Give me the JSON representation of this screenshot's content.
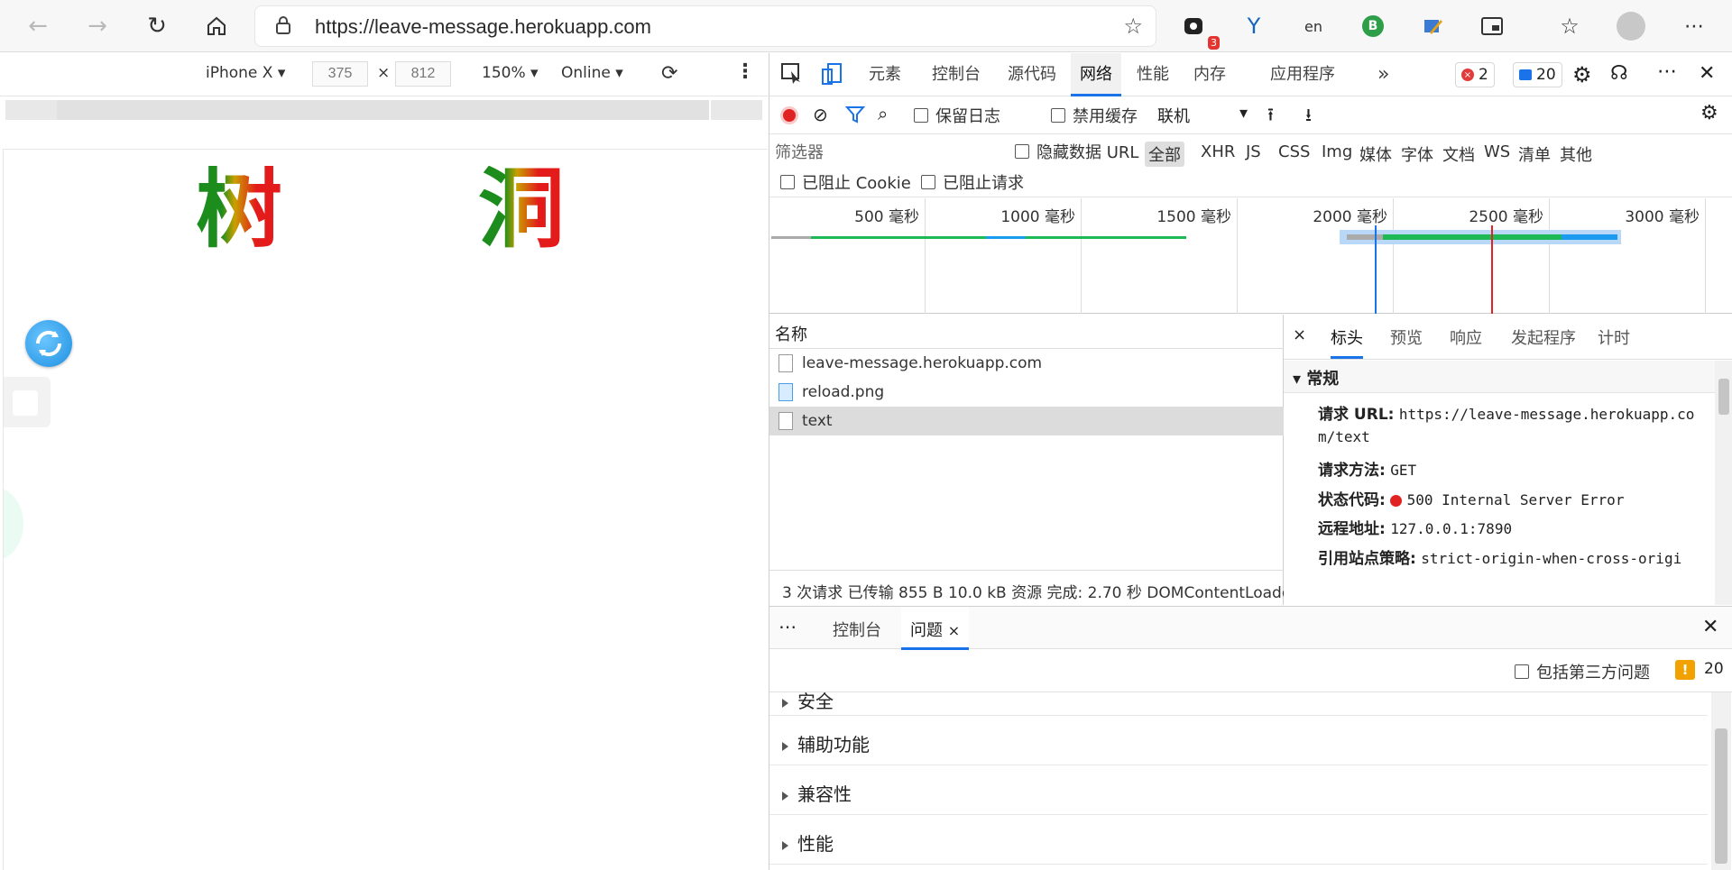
{
  "browser": {
    "url": "https://leave-message.herokuapp.com",
    "extension_badge": "3",
    "profile_letter": "B"
  },
  "device_toolbar": {
    "device": "iPhone X",
    "width": "375",
    "times": "×",
    "height": "812",
    "zoom": "150%",
    "throttle": "Online"
  },
  "page": {
    "char_left": "树",
    "char_right": "洞"
  },
  "devtools": {
    "tabs": [
      "元素",
      "控制台",
      "源代码",
      "网络",
      "性能",
      "内存",
      "应用程序"
    ],
    "active_tab": "网络",
    "more_tabs": "»",
    "error_count": "2",
    "message_count": "20",
    "toolbar": {
      "preserve_log": "保留日志",
      "disable_cache": "禁用缓存",
      "throttle": "联机"
    },
    "filter": {
      "placeholder": "筛选器",
      "hide_data_urls": "隐藏数据 URL",
      "types": [
        "全部",
        "XHR",
        "JS",
        "CSS",
        "Img",
        "媒体",
        "字体",
        "文档",
        "WS",
        "清单",
        "其他"
      ],
      "blocked_cookies": "已阻止 Cookie",
      "blocked_requests": "已阻止请求"
    },
    "overview_ticks": [
      "500 毫秒",
      "1000 毫秒",
      "1500 毫秒",
      "2000 毫秒",
      "2500 毫秒",
      "3000 毫秒"
    ],
    "requests": {
      "header": "名称",
      "items": [
        "leave-message.herokuapp.com",
        "reload.png",
        "text"
      ],
      "summary": "3 次请求   已传输 855 B   10.0 kB 资源   完成: 2.70 秒   DOMContentLoaded"
    },
    "detail": {
      "close": "×",
      "tabs": [
        "标头",
        "预览",
        "响应",
        "发起程序",
        "计时"
      ],
      "section": "常规",
      "fields": [
        {
          "key": "请求 URL:",
          "value": "https://leave-message.herokuapp.co",
          "value2": "m/text"
        },
        {
          "key": "请求方法:",
          "value": "GET"
        },
        {
          "key": "状态代码:",
          "value": "500 Internal Server Error"
        },
        {
          "key": "远程地址:",
          "value": "127.0.0.1:7890"
        },
        {
          "key": "引用站点策略:",
          "value": "strict-origin-when-cross-origi"
        }
      ]
    },
    "drawer": {
      "more": "⋯",
      "tabs": [
        "控制台",
        "问题"
      ],
      "tab_close": "×",
      "close": "✕",
      "include_third_party": "包括第三方问题",
      "issue_count": "20",
      "issues": [
        "安全",
        "辅助功能",
        "兼容性",
        "性能"
      ]
    }
  }
}
